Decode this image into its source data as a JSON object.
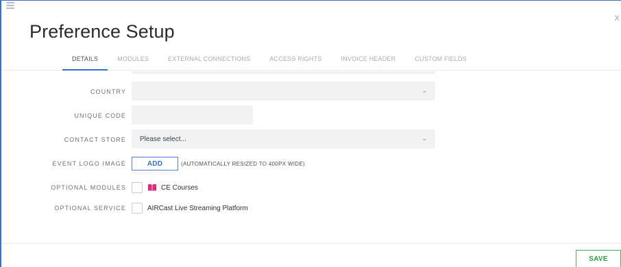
{
  "page": {
    "title": "Preference Setup",
    "close_glyph": "X"
  },
  "tabs": [
    {
      "label": "DETAILS",
      "active": true
    },
    {
      "label": "MODULES",
      "active": false
    },
    {
      "label": "EXTERNAL CONNECTIONS",
      "active": false
    },
    {
      "label": "ACCESS RIGHTS",
      "active": false
    },
    {
      "label": "INVOICE HEADER",
      "active": false
    },
    {
      "label": "CUSTOM FIELDS",
      "active": false
    }
  ],
  "form": {
    "country": {
      "label": "COUNTRY",
      "value": ""
    },
    "unique_code": {
      "label": "UNIQUE CODE",
      "value": ""
    },
    "contact_store": {
      "label": "CONTACT STORE",
      "value": "Please select..."
    },
    "event_logo": {
      "label": "EVENT LOGO IMAGE",
      "button_label": "ADD",
      "hint": "(AUTOMATICALLY RESIZED TO 400PX WIDE)"
    },
    "optional_modules": {
      "label": "OPTIONAL MODULES",
      "option_label": "CE Courses",
      "checked": false,
      "icon": "book-icon"
    },
    "optional_service": {
      "label": "OPTIONAL SERVICE",
      "option_label": "AIRCast Live Streaming Platform",
      "checked": false
    }
  },
  "footer": {
    "save_label": "SAVE"
  },
  "colors": {
    "accent": "#2f6fd1",
    "save": "#3fae56",
    "module_icon": "#e0287a"
  }
}
